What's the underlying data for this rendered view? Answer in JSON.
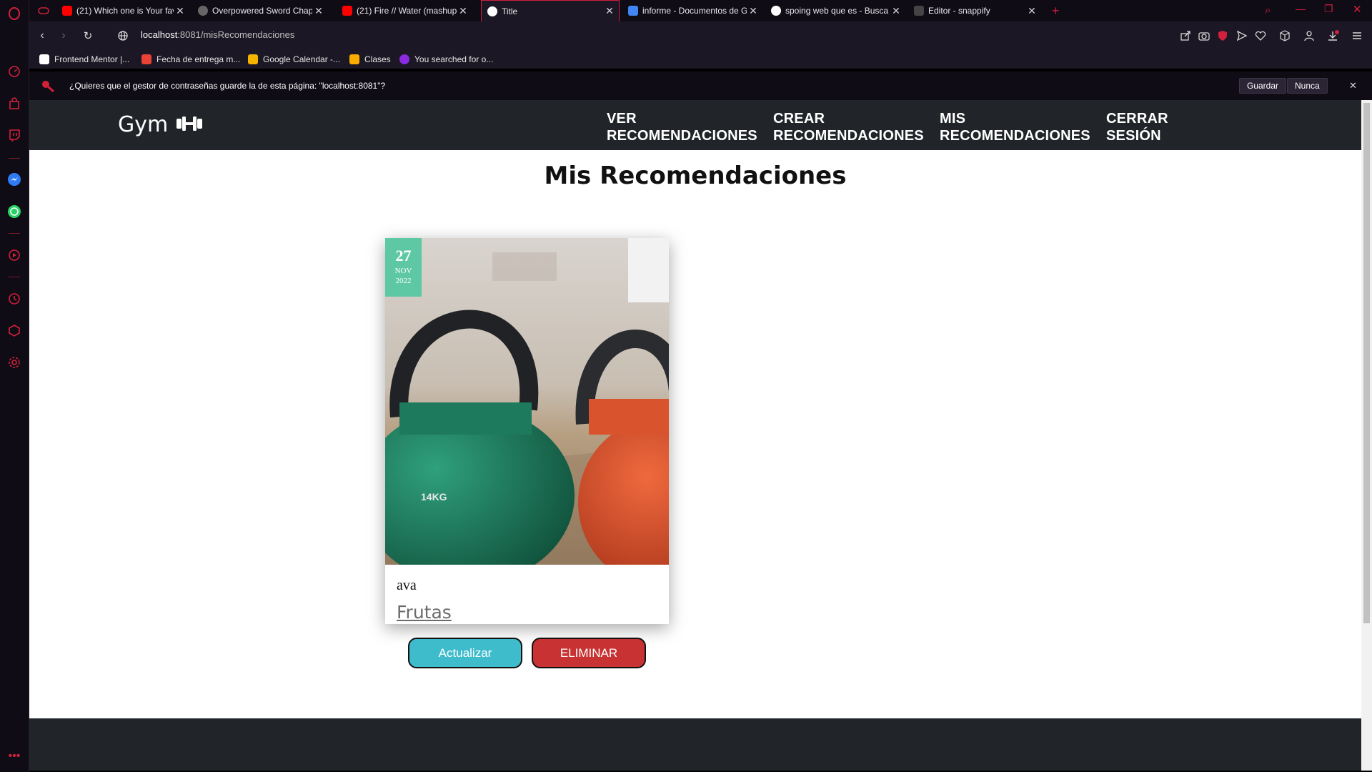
{
  "browser": {
    "tabs": [
      {
        "title": "(21) Which one is Your fav",
        "favicon": "youtube-icon",
        "color": "#ff0000"
      },
      {
        "title": "Overpowered Sword Chapt",
        "favicon": "web-icon",
        "color": "#666666"
      },
      {
        "title": "(21) Fire // Water (mashup)",
        "favicon": "youtube-icon",
        "color": "#ff0000"
      },
      {
        "title": "Title",
        "favicon": "globe-icon",
        "color": "#ffffff"
      },
      {
        "title": "informe - Documentos de G",
        "favicon": "docs-icon",
        "color": "#4285f4"
      },
      {
        "title": "spoing web que es - Busca",
        "favicon": "google-icon",
        "color": "#ffffff"
      },
      {
        "title": "Editor - snappify",
        "favicon": "snappify-icon",
        "color": "#444444"
      }
    ],
    "url_host": "localhost",
    "url_path": ":8081/misRecomendaciones",
    "bookmarks": [
      {
        "label": "Frontend Mentor |...",
        "favicon": "frontend-mentor-icon",
        "color": "#ffffff"
      },
      {
        "label": "Fecha de entrega m...",
        "favicon": "gmail-icon",
        "color": "#ea4335"
      },
      {
        "label": "Google Calendar -...",
        "favicon": "calendar-icon",
        "color": "#f4b400"
      },
      {
        "label": "Clases",
        "favicon": "classroom-icon",
        "color": "#f9ab00"
      },
      {
        "label": "You searched for o...",
        "favicon": "snappify-icon",
        "color": "#8a2be2"
      }
    ],
    "password_prompt": "¿Quieres que el gestor de contraseñas guarde la de esta página: \"localhost:8081\"?",
    "save_label": "Guardar",
    "never_label": "Nunca",
    "accent_color": "#d0203a"
  },
  "site": {
    "brand": "Gym",
    "brand_icon": "dumbbell-icon",
    "nav": [
      {
        "line1": "VER",
        "line2": "RECOMENDACIONES"
      },
      {
        "line1": "CREAR",
        "line2": "RECOMENDACIONES"
      },
      {
        "line1": "MIS",
        "line2": "RECOMENDACIONES"
      },
      {
        "line1": "CERRAR",
        "line2": "SESIÓN"
      }
    ],
    "heading": "Mis Recomendaciones",
    "card": {
      "day": "27",
      "month": "NOV",
      "year": "2022",
      "title": "ava",
      "category": "Frutas",
      "image_label": "14KG",
      "badge_color": "#5ec8a5"
    },
    "update_label": "Actualizar",
    "delete_label": "ELIMINAR",
    "update_color": "#3fbccc",
    "delete_color": "#c83232"
  }
}
